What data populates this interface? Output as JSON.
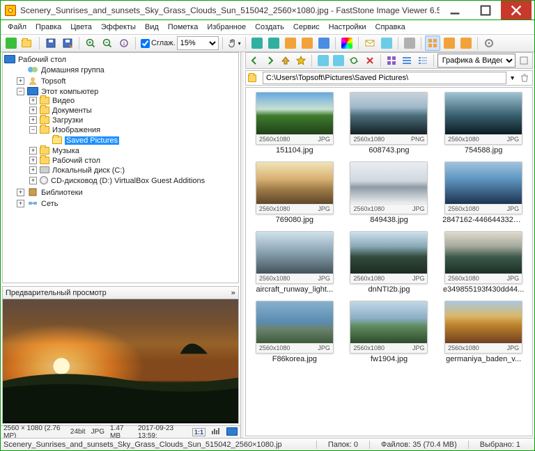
{
  "title": "Scenery_Sunrises_and_sunsets_Sky_Grass_Clouds_Sun_515042_2560×1080.jpg  -  FastStone Image Viewer 6.5",
  "menu": [
    "Файл",
    "Правка",
    "Цвета",
    "Эффекты",
    "Вид",
    "Пометка",
    "Избранное",
    "Создать",
    "Сервис",
    "Настройки",
    "Справка"
  ],
  "toolbar": {
    "smooth_label": "Сглаж.",
    "zoom": "15%",
    "view_filter": "Графика & Видео"
  },
  "tree": {
    "root": "Рабочий стол",
    "n1": "Домашняя группа",
    "n2": "Topsoft",
    "n3": "Этот компьютер",
    "n3_1": "Видео",
    "n3_2": "Документы",
    "n3_3": "Загрузки",
    "n3_4": "Изображения",
    "n3_4_1": "Saved Pictures",
    "n3_5": "Музыка",
    "n3_6": "Рабочий стол",
    "n3_7": "Локальный диск (C:)",
    "n3_8": "CD-дисковод (D:) VirtualBox Guest Additions",
    "n4": "Библиотеки",
    "n5": "Сеть"
  },
  "preview_title": "Предварительный просмотр",
  "preview_expand": "»",
  "left_status": {
    "dims": "2560 × 1080 (2.76 MP)",
    "depth": "24bit",
    "fmt": "JPG",
    "size": "1.47 MB",
    "date": "2017-09-23 13:59:",
    "one2one": "1:1"
  },
  "path": "C:\\Users\\Topsoft\\Pictures\\Saved Pictures\\",
  "thumbs": [
    {
      "res": "2560x1080",
      "fmt": "JPG",
      "name": "151104.jpg",
      "bg": "linear-gradient(to bottom,#66a9e0 0%,#c9e0d1 40%,#3f7c2e 55%,#1f4018 100%)"
    },
    {
      "res": "2560x1080",
      "fmt": "PNG",
      "name": "608743.png",
      "bg": "linear-gradient(to bottom,#c8d3db 0%,#9fb8c9 35%,#4b6e7b 55%,#152024 100%)"
    },
    {
      "res": "2560x1080",
      "fmt": "JPG",
      "name": "754588.jpg",
      "bg": "linear-gradient(to bottom,#9fc4d5 0%,#385f6e 55%,#0c1b22 100%)"
    },
    {
      "res": "2560x1080",
      "fmt": "JPG",
      "name": "769080.jpg",
      "bg": "linear-gradient(to bottom,#f0e4b6 0%,#d9b174 40%,#9e7a47 65%,#5f472a 100%)"
    },
    {
      "res": "2560x1080",
      "fmt": "JPG",
      "name": "849438.jpg",
      "bg": "linear-gradient(to bottom,#e8eef3 0%,#d0d7de 45%,#8e9aa4 60%,#eef1f4 100%)"
    },
    {
      "res": "2560x1080",
      "fmt": "JPG",
      "name": "2847162-44664433226...",
      "bg": "linear-gradient(to bottom,#a0c4e0 0%,#5f96c0 40%,#1c3350 100%)"
    },
    {
      "res": "2560x1080",
      "fmt": "JPG",
      "name": "aircraft_runway_light...",
      "bg": "linear-gradient(to bottom,#d0e2ec 0%,#8fa8b6 45%,#43525c 100%)"
    },
    {
      "res": "2560x1080",
      "fmt": "JPG",
      "name": "dnNTI2b.jpg",
      "bg": "linear-gradient(to bottom,#cfe0ec 0%,#89a9b8 35%,#324b3c 60%,#1b2b1f 100%)"
    },
    {
      "res": "2560x1080",
      "fmt": "JPG",
      "name": "e349855193f430dd44...",
      "bg": "linear-gradient(to bottom,#e0dbce 0%,#a4a99c 35%,#3e5a4c 60%,#1a2f24 100%)"
    },
    {
      "res": "2560x1080",
      "fmt": "JPG",
      "name": "F86korea.jpg",
      "bg": "linear-gradient(to bottom,#87b0ce 0%,#5a8bb0 50%,#6c8470 65%,#3e5a3a 100%)"
    },
    {
      "res": "2560x1080",
      "fmt": "JPG",
      "name": "fw1904.jpg",
      "bg": "linear-gradient(to bottom,#c3d8e6 0%,#8bb0c8 40%,#5f8a5c 60%,#2f4a2e 100%)"
    },
    {
      "res": "2560x1080",
      "fmt": "JPG",
      "name": "germaniya_baden_v...",
      "bg": "linear-gradient(to bottom,#a8c8e0 0%,#d9b86a 35%,#c0862d 55%,#6f3f20 100%)"
    }
  ],
  "footer": {
    "file": "Scenery_Sunrises_and_sunsets_Sky_Grass_Clouds_Sun_515042_2560×1080.jp",
    "folders": "Папок: 0",
    "files": "Файлов: 35 (70.4 MB)",
    "selected": "Выбрано: 1"
  }
}
